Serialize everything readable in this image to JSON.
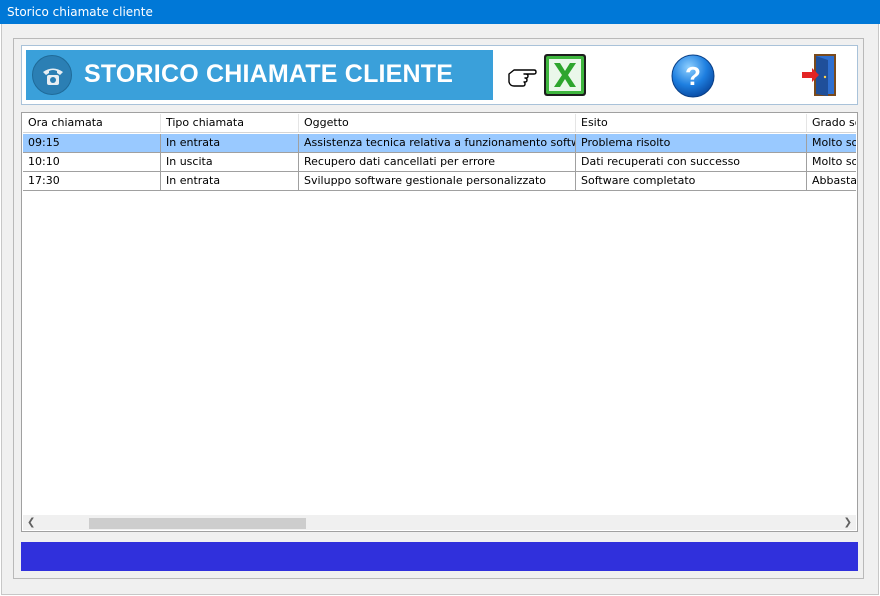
{
  "window": {
    "title": "Storico chiamate cliente"
  },
  "toolbar": {
    "banner_title": "STORICO CHIAMATE CLIENTE",
    "icons": [
      "phone-icon",
      "pointing-hand-icon",
      "excel-export-icon",
      "help-icon",
      "exit-door-icon"
    ]
  },
  "grid": {
    "columns": [
      "Ora chiamata",
      "Tipo chiamata",
      "Oggetto",
      "Esito",
      "Grado soddisfazione"
    ],
    "rows": [
      {
        "ora": "09:15",
        "tipo": "In entrata",
        "oggetto": "Assistenza tecnica relativa a funzionamento software",
        "esito": "Problema risolto",
        "grado": "Molto soddisfatto"
      },
      {
        "ora": "10:10",
        "tipo": "In uscita",
        "oggetto": "Recupero dati cancellati per errore",
        "esito": "Dati recuperati con successo",
        "grado": "Molto soddisfatto"
      },
      {
        "ora": "17:30",
        "tipo": "In entrata",
        "oggetto": "Sviluppo software gestionale personalizzato",
        "esito": "Software completato",
        "grado": "Abbastanza soddisfatto"
      }
    ],
    "selected_row": 0
  },
  "colors": {
    "titlebar": "#0078d7",
    "banner": "#3aa0da",
    "selection": "#99c9ff",
    "statusbar": "#3030dc"
  }
}
